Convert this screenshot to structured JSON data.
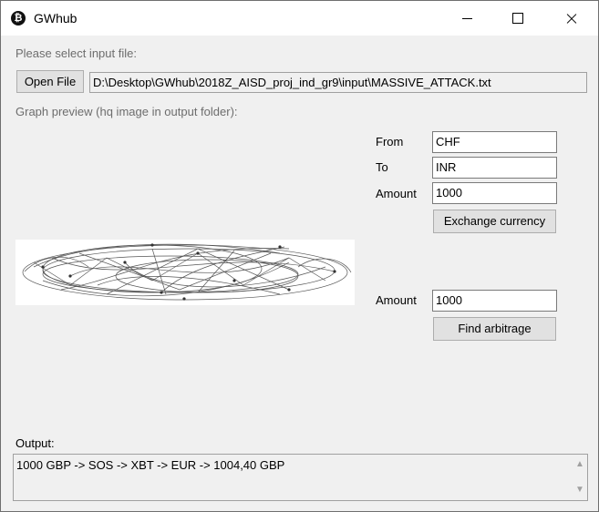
{
  "window": {
    "title": "GWhub"
  },
  "file": {
    "prompt": "Please select input file:",
    "open_button": "Open File",
    "path": "D:\\Desktop\\GWhub\\2018Z_AISD_proj_ind_gr9\\input\\MASSIVE_ATTACK.txt"
  },
  "graph": {
    "label": "Graph preview (hq image in output folder):"
  },
  "exchange": {
    "from_label": "From",
    "from_value": "CHF",
    "to_label": "To",
    "to_value": "INR",
    "amount_label": "Amount",
    "amount_value": "1000",
    "button": "Exchange currency"
  },
  "arbitrage": {
    "amount_label": "Amount",
    "amount_value": "1000",
    "button": "Find arbitrage"
  },
  "output": {
    "label": "Output:",
    "text": "1000 GBP -> SOS -> XBT -> EUR -> 1004,40 GBP"
  }
}
